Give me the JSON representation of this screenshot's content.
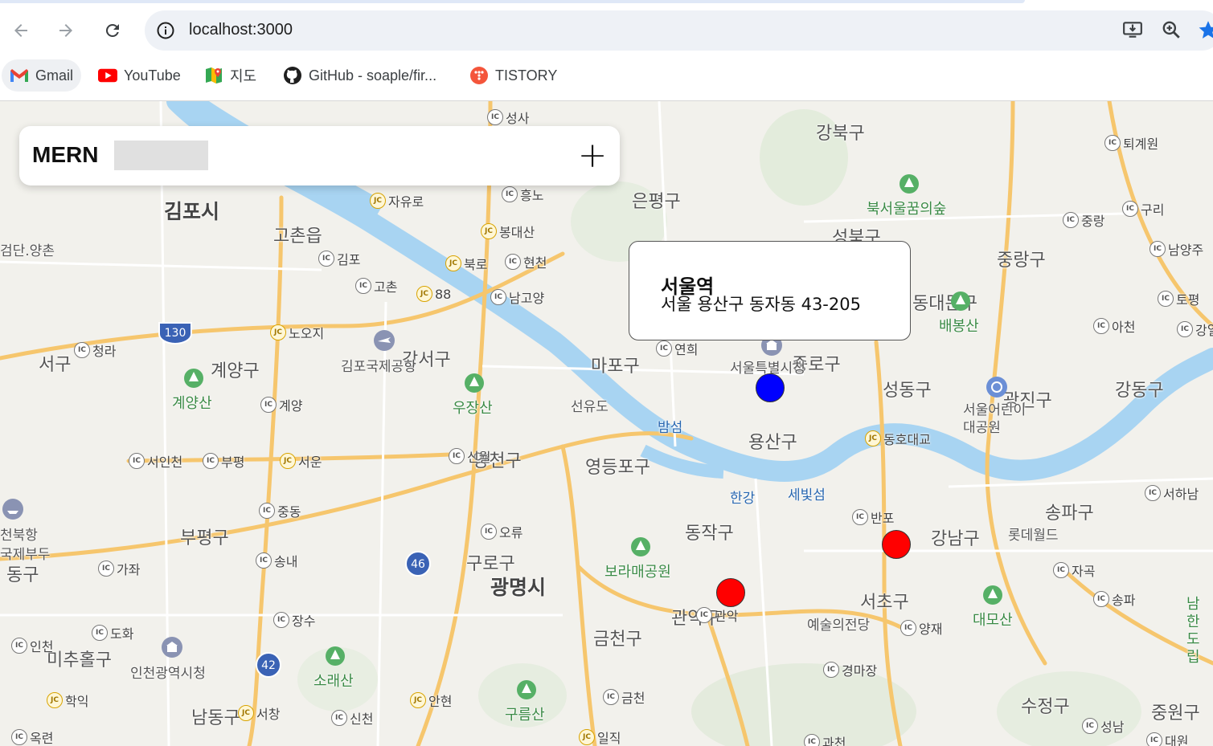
{
  "browser": {
    "url": "localhost:3000",
    "icons": {
      "back": "back-arrow-icon",
      "forward": "forward-arrow-icon",
      "reload": "reload-icon",
      "info": "info-icon",
      "install": "install-app-icon",
      "zoom": "zoom-icon",
      "bookmark": "star-icon"
    },
    "bookmarks": [
      {
        "label": "Gmail",
        "icon": "gmail-icon"
      },
      {
        "label": "YouTube",
        "icon": "youtube-icon"
      },
      {
        "label": "지도",
        "icon": "google-maps-icon"
      },
      {
        "label": "GitHub - soaple/fir...",
        "icon": "github-icon"
      },
      {
        "label": "TISTORY",
        "icon": "tistory-icon"
      }
    ]
  },
  "header": {
    "brand": "MERN",
    "search_value": "",
    "add_label": "+"
  },
  "popup": {
    "title": "서울역",
    "address": "서울 용산구 동자동 43-205"
  },
  "markers": [
    {
      "name": "selected-marker",
      "color": "#0000ff"
    },
    {
      "name": "place-marker",
      "color": "#ff0000"
    },
    {
      "name": "place-marker",
      "color": "#ff0000"
    }
  ],
  "map": {
    "districts": [
      "김포시",
      "강북구",
      "은평구",
      "성북구",
      "중랑구",
      "마포구",
      "서구",
      "계양구",
      "강서구",
      "성동구",
      "강동구",
      "용산구",
      "영등포구",
      "양천구",
      "부평구",
      "동작구",
      "강남구",
      "송파구",
      "구로구",
      "광명시",
      "서초구",
      "미추홀구",
      "남동구",
      "수정구",
      "중원구",
      "동구",
      "종로구",
      "동대문구",
      "광진구",
      "관악구",
      "금천구"
    ],
    "places": [
      "고촌읍",
      "검단.양촌",
      "선유도",
      "밤섬",
      "한강",
      "세빛섬",
      "김포국제공항",
      "서울특별시청",
      "롯데월드",
      "예술의전당",
      "인천광역시청",
      "서울어린이대공원",
      "천북항",
      "국제부두"
    ],
    "parks": [
      "북서울꿈의숲",
      "배봉산",
      "계양산",
      "우장산",
      "보라매공원",
      "대모산",
      "소래산",
      "구름산",
      "남한도립"
    ],
    "interchanges": [
      {
        "t": "IC",
        "n": "성사"
      },
      {
        "t": "IC",
        "n": "퇴계원"
      },
      {
        "t": "IC",
        "n": "흥노"
      },
      {
        "t": "JC",
        "n": "자유로"
      },
      {
        "t": "JC",
        "n": "봉대산"
      },
      {
        "t": "IC",
        "n": "김포"
      },
      {
        "t": "JC",
        "n": "북로"
      },
      {
        "t": "IC",
        "n": "현천"
      },
      {
        "t": "IC",
        "n": "고촌"
      },
      {
        "t": "JC",
        "n": "88"
      },
      {
        "t": "IC",
        "n": "남고양"
      },
      {
        "t": "IC",
        "n": "중랑"
      },
      {
        "t": "IC",
        "n": "구리"
      },
      {
        "t": "IC",
        "n": "남양주"
      },
      {
        "t": "IC",
        "n": "토평"
      },
      {
        "t": "IC",
        "n": "아천"
      },
      {
        "t": "IC",
        "n": "강일"
      },
      {
        "t": "JC",
        "n": "노오지"
      },
      {
        "t": "IC",
        "n": "청라"
      },
      {
        "t": "IC",
        "n": "계양"
      },
      {
        "t": "IC",
        "n": "연희"
      },
      {
        "t": "JC",
        "n": "동호대교"
      },
      {
        "t": "IC",
        "n": "서인천"
      },
      {
        "t": "IC",
        "n": "부평"
      },
      {
        "t": "JC",
        "n": "서운"
      },
      {
        "t": "IC",
        "n": "신월"
      },
      {
        "t": "IC",
        "n": "서하남"
      },
      {
        "t": "IC",
        "n": "중동"
      },
      {
        "t": "IC",
        "n": "반포"
      },
      {
        "t": "IC",
        "n": "오류"
      },
      {
        "t": "IC",
        "n": "송내"
      },
      {
        "t": "IC",
        "n": "가좌"
      },
      {
        "t": "IC",
        "n": "자곡"
      },
      {
        "t": "IC",
        "n": "송파"
      },
      {
        "t": "IC",
        "n": "관악"
      },
      {
        "t": "IC",
        "n": "양재"
      },
      {
        "t": "IC",
        "n": "장수"
      },
      {
        "t": "IC",
        "n": "도화"
      },
      {
        "t": "IC",
        "n": "인천"
      },
      {
        "t": "IC",
        "n": "금천"
      },
      {
        "t": "IC",
        "n": "경마장"
      },
      {
        "t": "JC",
        "n": "학익"
      },
      {
        "t": "JC",
        "n": "서창"
      },
      {
        "t": "IC",
        "n": "신천"
      },
      {
        "t": "JC",
        "n": "안현"
      },
      {
        "t": "IC",
        "n": "성남"
      },
      {
        "t": "IC",
        "n": "대원"
      },
      {
        "t": "IC",
        "n": "옥련"
      },
      {
        "t": "JC",
        "n": "일직"
      },
      {
        "t": "IC",
        "n": "과천"
      }
    ],
    "route_shields": [
      "130",
      "46",
      "42"
    ]
  }
}
